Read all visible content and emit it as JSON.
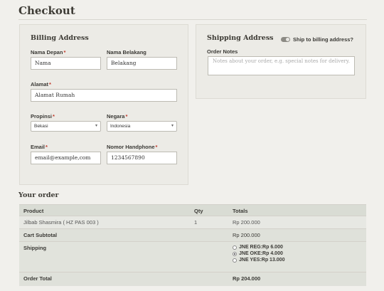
{
  "page_title": "Checkout",
  "billing": {
    "title": "Billing Address",
    "first_name": {
      "label": "Nama Depan",
      "value": "Nama"
    },
    "last_name": {
      "label": "Nama Belakang",
      "value": "Belakang"
    },
    "address": {
      "label": "Alamat",
      "value": "Alamat Rumah"
    },
    "province": {
      "label": "Propinsi",
      "value": "Bekasi"
    },
    "country": {
      "label": "Negara",
      "value": "Indonesia"
    },
    "email": {
      "label": "Email",
      "value": "email@example,com"
    },
    "phone": {
      "label": "Nomor Handphone",
      "value": "1234567890"
    }
  },
  "shipping": {
    "title": "Shipping Address",
    "toggle_label": "Ship to billing address?",
    "notes_label": "Order Notes",
    "notes_placeholder": "Notes about your order, e.g. special notes for delivery."
  },
  "order": {
    "title": "Your order",
    "headers": {
      "product": "Product",
      "qty": "Qty",
      "totals": "Totals"
    },
    "items": [
      {
        "product": "Jilbab Shasmira ( HZ PAS 003 )",
        "qty": "1",
        "total": "Rp 200.000"
      }
    ],
    "subtotal_label": "Cart Subtotal",
    "subtotal_value": "Rp 200.000",
    "shipping_label": "Shipping",
    "shipping_options": [
      {
        "label": "JNE REG:Rp 6.000",
        "selected": false
      },
      {
        "label": "JNE OKE:Rp 4.000",
        "selected": true
      },
      {
        "label": "JNE YES:Rp 13.000",
        "selected": false
      }
    ],
    "total_label": "Order Total",
    "total_value": "Rp 204.000"
  }
}
